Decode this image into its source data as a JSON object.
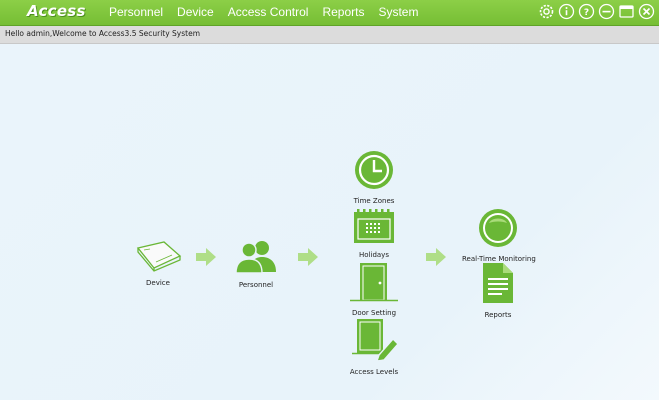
{
  "app": {
    "logo": "Access",
    "menu": [
      "Personnel",
      "Device",
      "Access Control",
      "Reports",
      "System"
    ],
    "controls": [
      "settings-icon",
      "info-icon",
      "help-icon",
      "minimize-icon",
      "maximize-icon",
      "close-icon"
    ]
  },
  "welcome": "Hello admin,Welcome to Access3.5 Security System",
  "flow": {
    "device": "Device",
    "personnel": "Personnel",
    "time_zones": "Time Zones",
    "holidays": "Holidays",
    "door_setting": "Door Setting",
    "access_levels": "Access Levels",
    "realtime": "Real-Time Monitoring",
    "reports": "Reports"
  },
  "colors": {
    "brand_green": "#7ac142",
    "icon_green": "#6ab736",
    "welcome_bar": "#dcdcdc",
    "canvas": "#e9f3fa"
  }
}
